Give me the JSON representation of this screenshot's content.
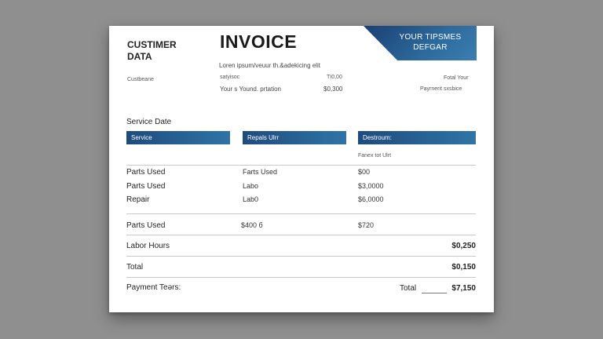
{
  "header": {
    "customer_label": [
      "CUSTIMER",
      "DATA"
    ],
    "title": "INVOICE",
    "banner": [
      "YOUR TIPSMES",
      "DEFGAR"
    ],
    "lorem": "Loren ipsum/veuur th.&adekicing elit",
    "customer_name": "Custbeane",
    "lines": [
      {
        "label": "satyisoc",
        "value": "TI0,00"
      },
      {
        "label": "Your s Yound. prtation",
        "value": "$0,300"
      }
    ],
    "right_lines": [
      "Fotal Your",
      "Payrnerit sxsbice"
    ]
  },
  "service_date": "Service Date",
  "columns": [
    "Service",
    "Repals Ulrr",
    "Destroum:"
  ],
  "subheader": "Fanex tot Ulrt",
  "items": [
    {
      "label": "Parts Used",
      "mid": "Farts Used",
      "value": "$00"
    },
    {
      "label": "Parts Used",
      "mid": "Labo",
      "value": "$3,0000"
    },
    {
      "label": "Repair",
      "mid": "Lab0",
      "value": "$6,0000"
    }
  ],
  "summary": {
    "label": "Parts Used",
    "mid": "$400 б",
    "value": "$720"
  },
  "labor": {
    "label": "Labor Hours",
    "value": "$0,250"
  },
  "total_row": {
    "label": "Total",
    "value": "$0,150"
  },
  "payment": {
    "label": "Payment Teərs:",
    "total_label": "Total",
    "total_value": "$7,150"
  }
}
